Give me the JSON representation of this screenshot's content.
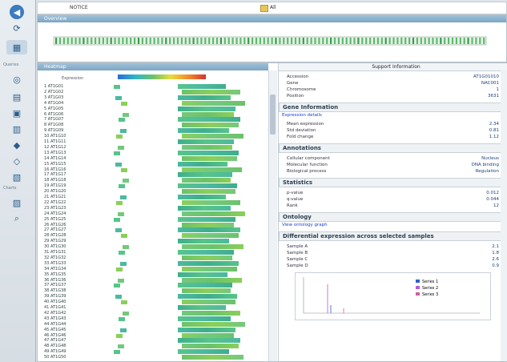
{
  "sidebar": {
    "sections": [
      "Queries",
      "Charts"
    ],
    "buttons": [
      "back-icon",
      "refresh-icon",
      "window-icon",
      "query-icon",
      "table-icon",
      "grid-icon",
      "chart-icon",
      "filter-icon",
      "tag-icon",
      "bar-icon",
      "stats-icon",
      "select-icon",
      "zoom-icon"
    ]
  },
  "topbar": {
    "crumb": "NOTICE",
    "folder_label": "All"
  },
  "overview": {
    "header": "Overview"
  },
  "main": {
    "left_header": "Heatmap",
    "legend_label": "Expression",
    "rows": [
      "1  AT1G01",
      "2  AT1G02",
      "3  AT1G03",
      "4  AT1G04",
      "5  AT1G05",
      "6  AT1G06",
      "7  AT1G07",
      "8  AT1G08",
      "9  AT1G09",
      "10 AT1G10",
      "11 AT1G11",
      "12 AT1G12",
      "13 AT1G13",
      "14 AT1G14",
      "15 AT1G15",
      "16 AT1G16",
      "17 AT1G17",
      "18 AT1G18",
      "19 AT1G19",
      "20 AT1G20",
      "21 AT1G21",
      "22 AT1G22",
      "23 AT1G23",
      "24 AT1G24",
      "25 AT1G25",
      "26 AT1G26",
      "27 AT1G27",
      "28 AT1G28",
      "29 AT1G29",
      "30 AT1G30",
      "31 AT1G31",
      "32 AT1G32",
      "33 AT1G33",
      "34 AT1G34",
      "35 AT1G35",
      "36 AT1G36",
      "37 AT1G37",
      "38 AT1G38",
      "39 AT1G39",
      "40 AT1G40",
      "41 AT1G41",
      "42 AT1G42",
      "43 AT1G43",
      "44 AT1G44",
      "45 AT1G45",
      "46 AT1G46",
      "47 AT1G47",
      "48 AT1G48",
      "49 AT1G49",
      "50 AT1G50"
    ],
    "right_header": "Support Information",
    "details": {
      "block1": [
        {
          "k": "Accession",
          "v": "AT1G01010"
        },
        {
          "k": "Gene",
          "v": "NAC001"
        },
        {
          "k": "Chromosome",
          "v": "1"
        },
        {
          "k": "Position",
          "v": "3631"
        }
      ],
      "sec2_title": "Gene Information",
      "link1": "Expression details",
      "block2": [
        {
          "k": "Mean expression",
          "v": "2.34"
        },
        {
          "k": "Std deviation",
          "v": "0.81"
        },
        {
          "k": "Fold change",
          "v": "1.12"
        }
      ],
      "sec3_title": "Annotations",
      "block3": [
        {
          "k": "Cellular component",
          "v": "Nucleus"
        },
        {
          "k": "Molecular function",
          "v": "DNA binding"
        },
        {
          "k": "Biological process",
          "v": "Regulation"
        }
      ],
      "sec4_title": "Statistics",
      "block4": [
        {
          "k": "p-value",
          "v": "0.012"
        },
        {
          "k": "q-value",
          "v": "0.044"
        },
        {
          "k": "Rank",
          "v": "12"
        }
      ],
      "sec5_title": "Ontology",
      "link2": "View ontology graph",
      "sec6_title": "Differential expression across selected samples",
      "block6": [
        {
          "k": "Sample A",
          "v": "2.1"
        },
        {
          "k": "Sample B",
          "v": "1.8"
        },
        {
          "k": "Sample C",
          "v": "2.6"
        },
        {
          "k": "Sample D",
          "v": "0.9"
        }
      ],
      "plot_legend": [
        "Series 1",
        "Series 2",
        "Series 3"
      ]
    }
  }
}
